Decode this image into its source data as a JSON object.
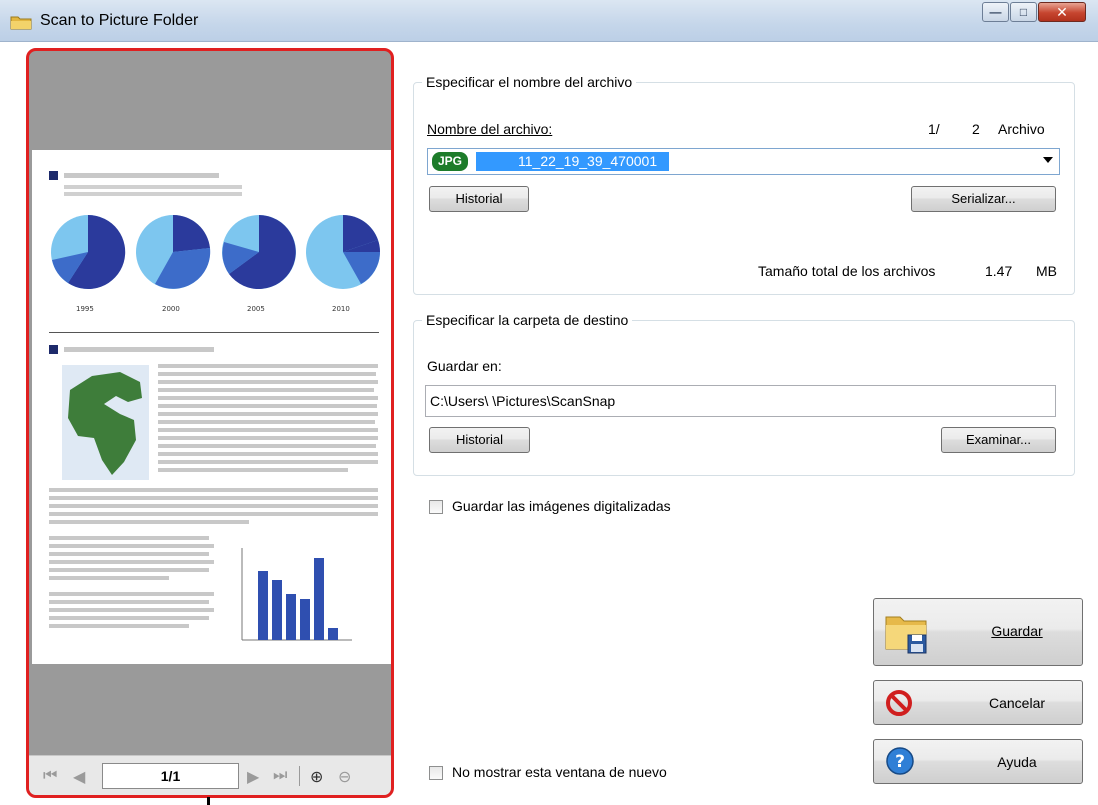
{
  "window": {
    "title": "Scan to Picture Folder"
  },
  "preview": {
    "page_indicator": "1/1",
    "chart_years": [
      "1995",
      "2000",
      "2005",
      "2010"
    ]
  },
  "filename_group": {
    "legend": "Especificar el nombre del archivo",
    "field_label": "Nombre del archivo:",
    "counter_current": "1/",
    "counter_total": "2",
    "counter_unit": "Archivo",
    "file_type_badge": "JPG",
    "filename_value": "11_22_19_39_470001",
    "history_button": "Historial",
    "serialize_button": "Serializar...",
    "total_size_label": "Tamaño total de los archivos",
    "total_size_value": "1.47",
    "total_size_unit": "MB"
  },
  "destination_group": {
    "legend": "Especificar la carpeta de destino",
    "save_in_label": "Guardar en:",
    "path_value": "C:\\Users\\      \\Pictures\\ScanSnap",
    "history_button": "Historial",
    "browse_button": "Examinar..."
  },
  "options": {
    "save_scanned_images": "Guardar las imágenes digitalizadas",
    "dont_show_again": "No mostrar esta ventana de nuevo"
  },
  "actions": {
    "save": "Guardar",
    "cancel": "Cancelar",
    "help": "Ayuda"
  },
  "colors": {
    "highlight_border": "#e02020",
    "selection": "#3399ff",
    "jpg_badge": "#1d7c2a"
  }
}
